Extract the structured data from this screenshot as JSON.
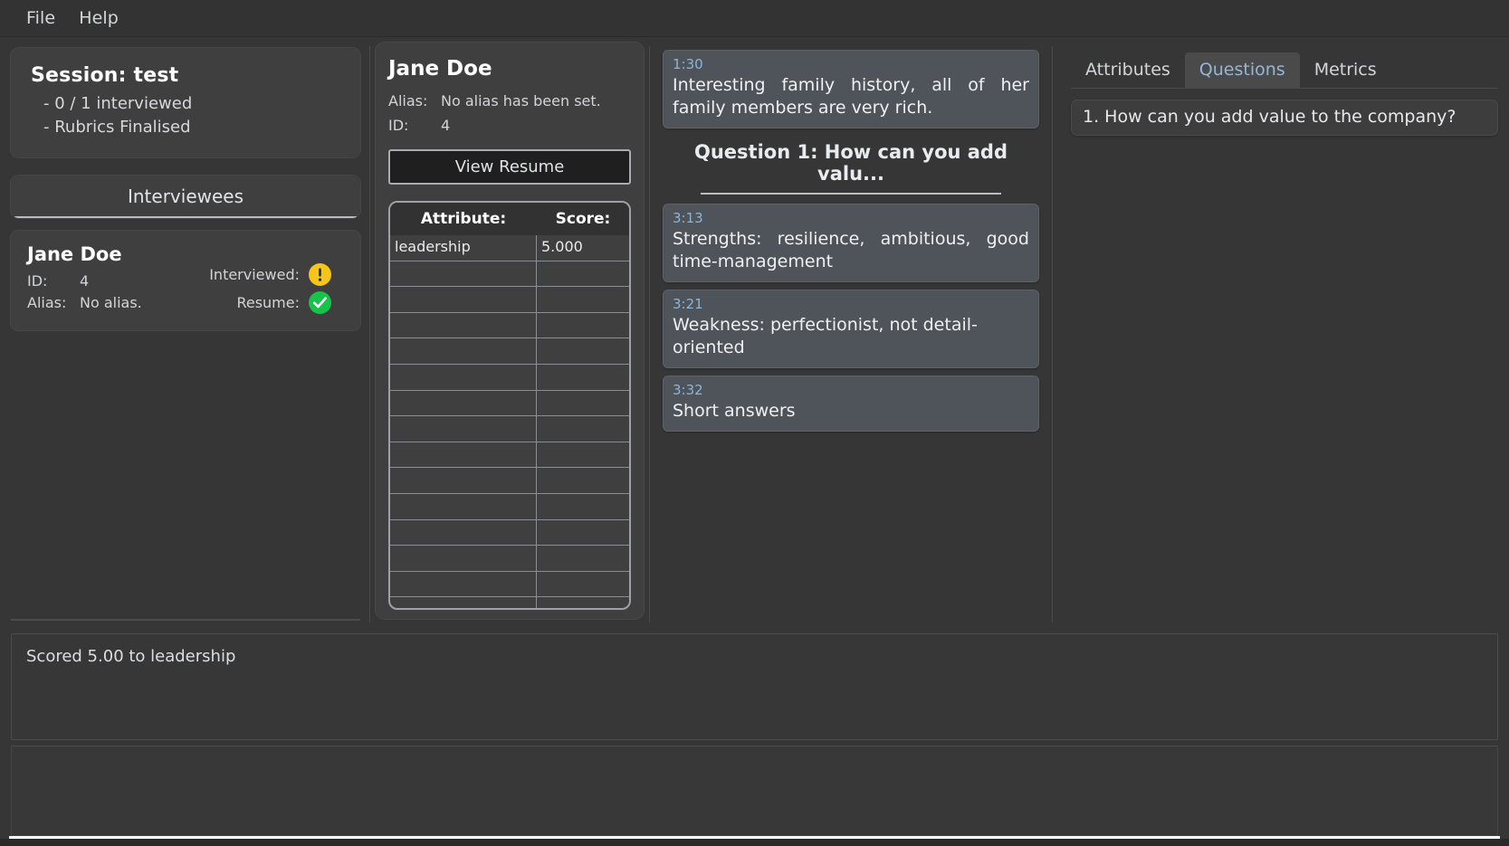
{
  "menubar": {
    "items": [
      {
        "label": "File"
      },
      {
        "label": "Help"
      }
    ]
  },
  "session": {
    "title": "Session: test",
    "lines": [
      "- 0 / 1 interviewed",
      "- Rubrics Finalised"
    ]
  },
  "interviewees": {
    "header": "Interviewees",
    "rows": [
      {
        "name": "Jane Doe",
        "id_label": "ID:",
        "id_value": "4",
        "alias_label": "Alias:",
        "alias_value": "No alias.",
        "interviewed_label": "Interviewed:",
        "interviewed_icon": "warning-icon",
        "interviewed_glyph": "!",
        "resume_label": "Resume:",
        "resume_icon": "check-icon",
        "resume_glyph": "✓"
      }
    ]
  },
  "detail": {
    "name": "Jane Doe",
    "alias_label": "Alias:",
    "alias_value": "No alias has been set.",
    "id_label": "ID:",
    "id_value": "4",
    "view_resume_label": "View Resume",
    "table": {
      "columns": [
        "Attribute:",
        "Score:"
      ],
      "rows": [
        {
          "attribute": "leadership",
          "score": "5.000"
        }
      ],
      "empty_row_count": 14
    }
  },
  "transcript": {
    "entries_before_question": [
      {
        "time": "1:30",
        "text": "Interesting family history, all of her family members are very rich."
      }
    ],
    "question_header": "Question 1: How can you add valu...",
    "entries_after_question": [
      {
        "time": "3:13",
        "text": "Strengths: resilience, ambitious, good time-management"
      },
      {
        "time": "3:21",
        "text": "Weakness: perfectionist, not detail-oriented"
      },
      {
        "time": "3:32",
        "text": "Short answers"
      }
    ]
  },
  "side_panel": {
    "tabs": [
      {
        "label": "Attributes",
        "active": false
      },
      {
        "label": "Questions",
        "active": true
      },
      {
        "label": "Metrics",
        "active": false
      }
    ],
    "questions": [
      "1. How can you add value to the company?"
    ]
  },
  "log": {
    "message": "Scored 5.00 to leadership"
  },
  "colors": {
    "window_background": "#363636",
    "card_background": "#3f3f3f",
    "bubble_background": "#4e5459",
    "timestamp": "#8fb4d6",
    "active_tab_text": "#93b7d8",
    "warning_badge": "#f5c518",
    "ok_badge": "#16c44a",
    "text_primary": "#e6e8eb"
  }
}
